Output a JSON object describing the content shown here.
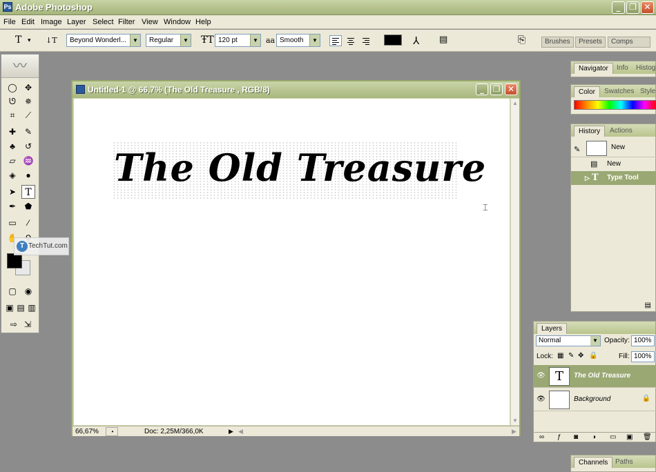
{
  "window": {
    "title": "Adobe Photoshop",
    "app_icon": "Ps"
  },
  "window_controls": {
    "minimize": "_",
    "maximize": "❐",
    "close": "✕"
  },
  "menu": [
    "File",
    "Edit",
    "Image",
    "Layer",
    "Select",
    "Filter",
    "View",
    "Window",
    "Help"
  ],
  "options": {
    "tool_glyph": "T",
    "orientation_glyph": "↓T",
    "font_family": "Beyond Wonderl...",
    "font_style": "Regular",
    "font_size": "120 pt",
    "antialias_label": "aa",
    "antialias": "Smooth",
    "text_color": "#000000",
    "warp_glyph": "⅄",
    "palettes_glyph": "▤"
  },
  "wells": [
    "Brushes",
    "Presets",
    "Comps"
  ],
  "document": {
    "title": "Untitled-1 @ 66,7% (The Old Treasure , RGB/8)",
    "canvas_text": "The Old Treasure",
    "zoom": "66,67%",
    "doc_info": "Doc: 2,25M/366,0K"
  },
  "watermark": {
    "logo": "T",
    "text": "TechTut.com"
  },
  "tools": {
    "marquee": "◯",
    "move": "✥",
    "lasso": "ᘎ",
    "wand": "✵",
    "crop": "⌗",
    "slice": "⟋",
    "heal": "✚",
    "brush": "✎",
    "stamp": "♣",
    "history_brush": "↺",
    "eraser": "▱",
    "bucket": "♒",
    "blur": "◈",
    "dodge": "●",
    "path_select": "➤",
    "type": "T",
    "pen": "✒",
    "shape": "⬟",
    "notes": "▭",
    "eyedropper": "⁄",
    "hand": "✋",
    "zoom": "⚲",
    "quickmask_std": "▢",
    "quickmask": "◉",
    "screen1": "▣",
    "screen2": "▤",
    "screen3": "▥",
    "jump1": "⇨",
    "jump2": "⇲"
  },
  "navigator_panel": {
    "tabs": [
      "Navigator",
      "Info",
      "Histogr"
    ]
  },
  "color_panel": {
    "tabs": [
      "Color",
      "Swatches",
      "Styles"
    ]
  },
  "history_panel": {
    "tabs": [
      "History",
      "Actions"
    ],
    "snapshot": "New",
    "items": [
      {
        "label": "New",
        "selected": false
      },
      {
        "label": "Type Tool",
        "selected": true
      }
    ]
  },
  "layers_panel": {
    "tab": "Layers",
    "blend_mode": "Normal",
    "opacity_label": "Opacity:",
    "opacity": "100%",
    "lock_label": "Lock:",
    "fill_label": "Fill:",
    "fill": "100%",
    "layers": [
      {
        "name": "The Old Treasure",
        "thumb": "T",
        "selected": true
      },
      {
        "name": "Background",
        "thumb": "",
        "selected": false,
        "locked": true
      }
    ],
    "footer_icons": [
      "∞",
      "ƒ",
      "◙",
      "◑",
      "▭",
      "▣",
      "🗑"
    ]
  },
  "channels_panel": {
    "tabs": [
      "Channels",
      "Paths"
    ]
  },
  "colors": {
    "accent": "#9aa873",
    "titlebar": "#a6b57c",
    "workspace": "#8c8c8c",
    "chrome": "#ece9d8"
  }
}
